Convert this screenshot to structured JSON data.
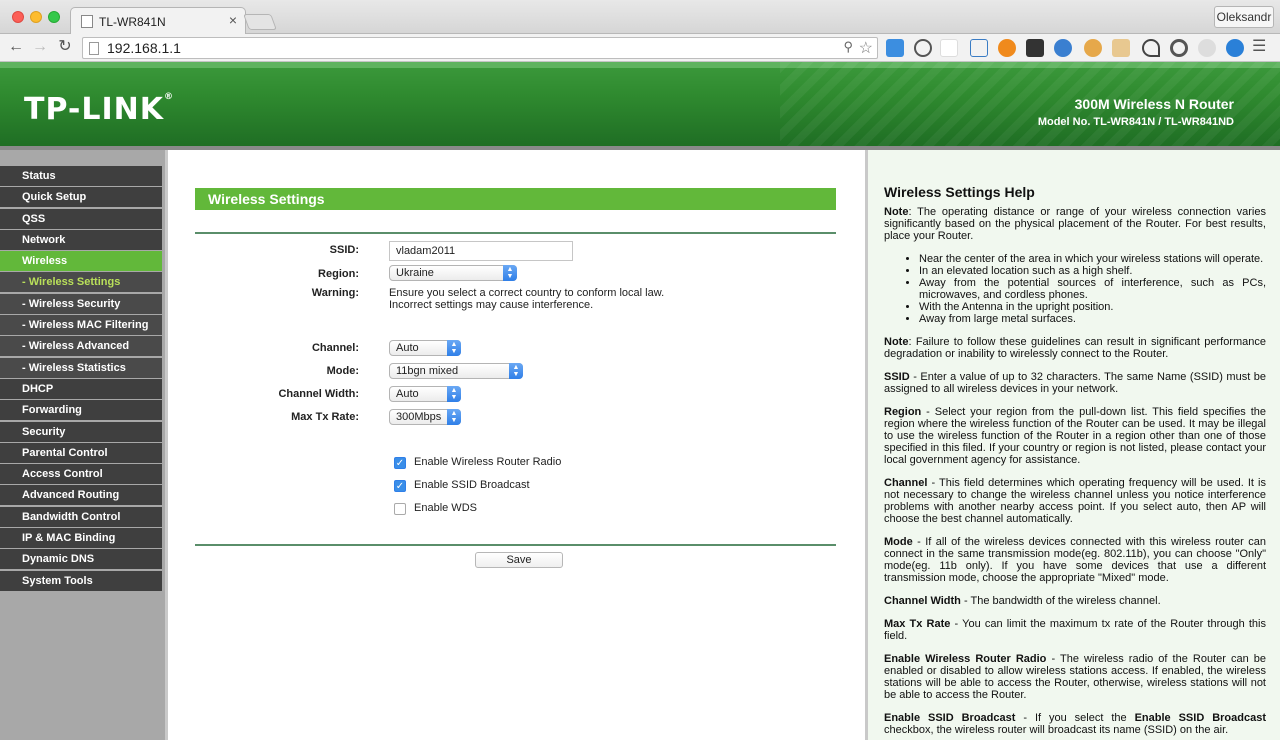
{
  "browser": {
    "tab_title": "TL-WR841N",
    "tab_close": "×",
    "url": "192.168.1.1",
    "profile_name": "Oleksandr"
  },
  "header": {
    "logo": "TP-LINK",
    "logo_mark": "®",
    "product": "300M Wireless N Router",
    "model": "Model No. TL-WR841N / TL-WR841ND"
  },
  "sidebar": {
    "items": [
      {
        "label": "Status"
      },
      {
        "label": "Quick Setup"
      },
      {
        "label": "QSS"
      },
      {
        "label": "Network"
      },
      {
        "label": "Wireless"
      },
      {
        "label": "- Wireless Settings"
      },
      {
        "label": "- Wireless Security"
      },
      {
        "label": "- Wireless MAC Filtering"
      },
      {
        "label": "- Wireless Advanced"
      },
      {
        "label": "- Wireless Statistics"
      },
      {
        "label": "DHCP"
      },
      {
        "label": "Forwarding"
      },
      {
        "label": "Security"
      },
      {
        "label": "Parental Control"
      },
      {
        "label": "Access Control"
      },
      {
        "label": "Advanced Routing"
      },
      {
        "label": "Bandwidth Control"
      },
      {
        "label": "IP & MAC Binding"
      },
      {
        "label": "Dynamic DNS"
      },
      {
        "label": "System Tools"
      }
    ]
  },
  "main": {
    "title": "Wireless Settings",
    "ssid": {
      "label": "SSID:",
      "value": "vladam2011"
    },
    "region": {
      "label": "Region:",
      "value": "Ukraine"
    },
    "warning": {
      "label": "Warning:",
      "line1": "Ensure you select a correct country to conform local law.",
      "line2": "Incorrect settings may cause interference."
    },
    "channel": {
      "label": "Channel:",
      "value": "Auto"
    },
    "mode": {
      "label": "Mode:",
      "value": "11bgn mixed"
    },
    "channel_width": {
      "label": "Channel Width:",
      "value": "Auto"
    },
    "max_tx_rate": {
      "label": "Max Tx Rate:",
      "value": "300Mbps"
    },
    "checkboxes": {
      "radio": {
        "label": "Enable Wireless Router Radio",
        "checked": true
      },
      "ssid_broadcast": {
        "label": "Enable SSID Broadcast",
        "checked": true
      },
      "wds": {
        "label": "Enable WDS",
        "checked": false
      }
    },
    "save_label": "Save"
  },
  "help": {
    "title": "Wireless Settings Help",
    "note1_term": "Note",
    "note1_text": ": The operating distance or range of your wireless connection varies significantly based on the physical placement of the Router. For best results, place your Router.",
    "bullets": [
      "Near the center of the area in which your wireless stations will operate.",
      "In an elevated location such as a high shelf.",
      "Away from the potential sources of interference, such as PCs, microwaves, and cordless phones.",
      "With the Antenna in the upright position.",
      "Away from large metal surfaces."
    ],
    "note2_term": "Note",
    "note2_text": ": Failure to follow these guidelines can result in significant performance degradation or inability to wirelessly connect to the Router.",
    "ssid_term": "SSID",
    "ssid_text": " - Enter a value of up to 32 characters. The same Name (SSID) must be assigned to all wireless devices in your network.",
    "region_term": "Region",
    "region_text": " - Select your region from the pull-down list. This field specifies the region where the wireless function of the Router can be used. It may be illegal to use the wireless function of the Router in a region other than one of those specified in this filed. If your country or region is not listed, please contact your local government agency for assistance.",
    "channel_term": "Channel",
    "channel_text": " - This field determines which operating frequency will be used. It is not necessary to change the wireless channel unless you notice interference problems with another nearby access point. If you select auto, then AP will choose the best channel automatically.",
    "mode_term": "Mode",
    "mode_text": " - If all of the wireless devices connected with this wireless router can connect in the same transmission mode(eg. 802.11b), you can choose \"Only\" mode(eg. 11b only). If you have some devices that use a different transmission mode, choose the appropriate \"Mixed\" mode.",
    "cw_term": "Channel Width",
    "cw_text": " - The bandwidth of the wireless channel.",
    "tx_term": "Max Tx Rate",
    "tx_text": " - You can limit the maximum tx rate of the Router through this field.",
    "radio_term": "Enable Wireless Router Radio",
    "radio_text": " - The wireless radio of the Router can be enabled or disabled to allow wireless stations access. If enabled, the wireless stations will be able to access the Router, otherwise, wireless stations will not be able to access the Router.",
    "bc_term": "Enable SSID Broadcast",
    "bc_text1": " - If you select the ",
    "bc_term2": "Enable SSID Broadcast",
    "bc_text2": " checkbox, the wireless router will broadcast its name (SSID) on the air."
  },
  "colors": {
    "header_green": "#2f8a2f",
    "menu_active": "#62b83a",
    "menu_bg": "#3f3f3f",
    "submenu_active_text": "#b9e05a",
    "help_bg": "#f1f8ef"
  }
}
